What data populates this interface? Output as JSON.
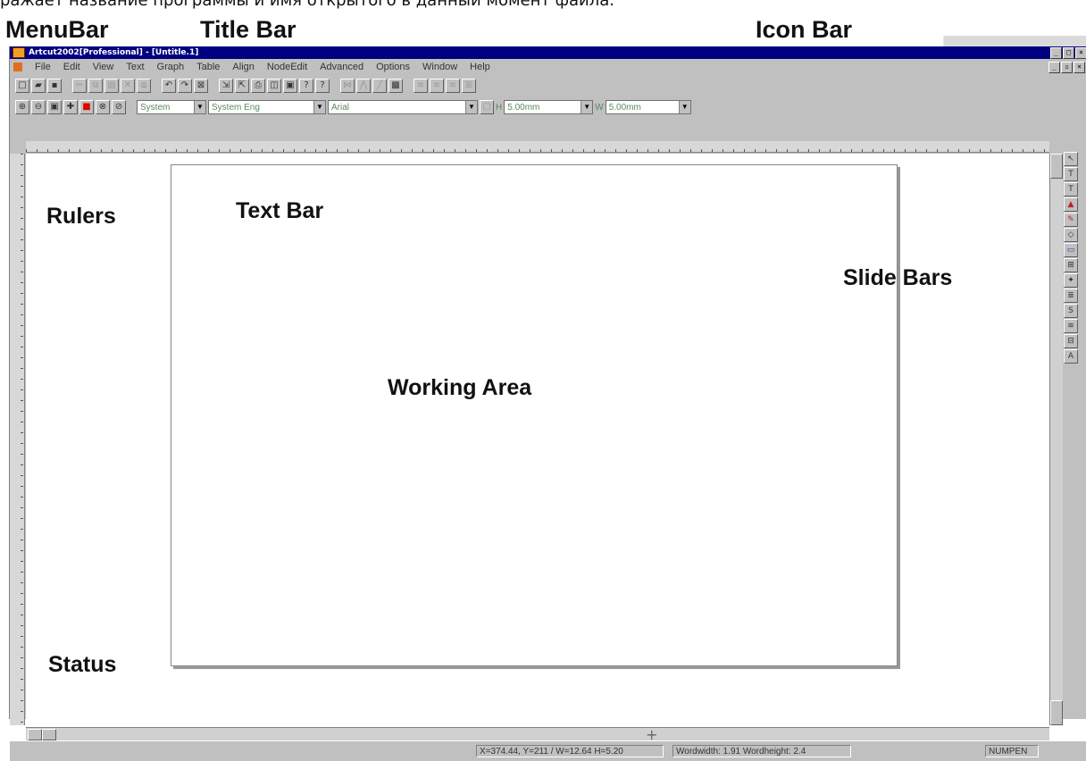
{
  "page_caption_cut": "ражает название программы и имя открытого в данный момент файла.",
  "annotations": {
    "menubar": "MenuBar",
    "title_bar": "Title Bar",
    "icon_bar": "Icon Bar",
    "rulers": "Rulers",
    "text_bar": "Text Bar",
    "slide_bars": "Slide Bars",
    "working_area": "Working Area",
    "status": "Status"
  },
  "window": {
    "title": "Artcut2002[Professional] - [Untitle.1]"
  },
  "menu": {
    "items": [
      "File",
      "Edit",
      "View",
      "Text",
      "Graph",
      "Table",
      "Align",
      "NodeEdit",
      "Advanced",
      "Options",
      "Window",
      "Help"
    ]
  },
  "text_toolbar": {
    "font_charset": "System",
    "language": "System Eng",
    "font_name": "Arial",
    "h_label": "H",
    "h_value": "5.00mm",
    "w_label": "W",
    "w_value": "5.00mm"
  },
  "status": {
    "coords": "X=374.44, Y=211 / W=12.64 H=5.20",
    "wordwidth": "Wordwidth: 1.91  Wordheight: 2.4",
    "mode": "NUMPEN"
  },
  "colors": {
    "title_bar": "#000080",
    "chrome": "#c0c0c0",
    "workspace": "#ffffff",
    "combo_text": "#5a8a5a"
  }
}
